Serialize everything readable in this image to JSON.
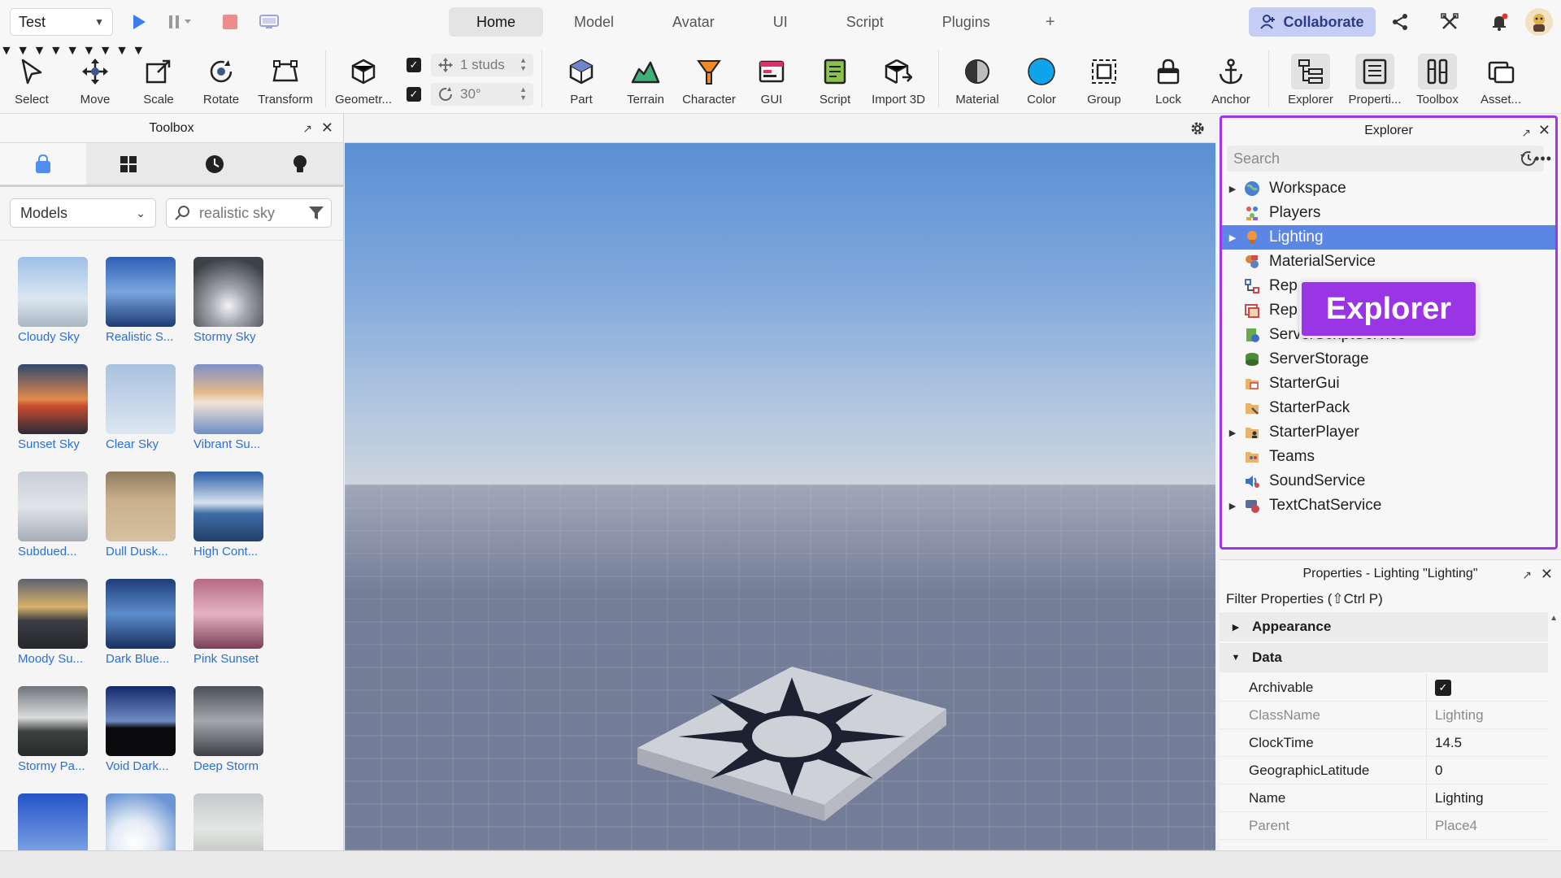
{
  "topbar": {
    "mode": "Test",
    "tabs": [
      "Home",
      "Model",
      "Avatar",
      "UI",
      "Script",
      "Plugins",
      "+"
    ],
    "active_tab": "Home",
    "collaborate": "Collaborate"
  },
  "ribbon": {
    "select": "Select",
    "move": "Move",
    "scale": "Scale",
    "rotate": "Rotate",
    "transform": "Transform",
    "geometry": "Geometr...",
    "move_snap": "1 studs",
    "rotate_snap": "30°",
    "part": "Part",
    "terrain": "Terrain",
    "character": "Character",
    "gui": "GUI",
    "script": "Script",
    "import3d": "Import 3D",
    "material": "Material",
    "color": "Color",
    "group": "Group",
    "lock": "Lock",
    "anchor": "Anchor",
    "explorer": "Explorer",
    "properties": "Properti...",
    "toolbox": "Toolbox",
    "asset": "Asset..."
  },
  "toolbox": {
    "title": "Toolbox",
    "category": "Models",
    "search_value": "realistic sky",
    "assets": [
      {
        "name": "Cloudy Sky"
      },
      {
        "name": "Realistic S..."
      },
      {
        "name": "Stormy Sky"
      },
      {
        "name": "Sunset Sky"
      },
      {
        "name": "Clear Sky"
      },
      {
        "name": "Vibrant Su..."
      },
      {
        "name": "Subdued..."
      },
      {
        "name": "Dull Dusk..."
      },
      {
        "name": "High Cont..."
      },
      {
        "name": "Moody Su..."
      },
      {
        "name": "Dark Blue..."
      },
      {
        "name": "Pink Sunset"
      },
      {
        "name": "Stormy Pa..."
      },
      {
        "name": "Void Dark..."
      },
      {
        "name": "Deep Storm"
      },
      {
        "name": ""
      },
      {
        "name": ""
      },
      {
        "name": ""
      }
    ]
  },
  "explorer": {
    "title": "Explorer",
    "search_placeholder": "Search",
    "callout": "Explorer",
    "items": [
      {
        "label": "Workspace",
        "expand": true,
        "icon": "globe-icon"
      },
      {
        "label": "Players",
        "expand": false,
        "icon": "players-icon"
      },
      {
        "label": "Lighting",
        "expand": true,
        "icon": "lightbulb-icon",
        "selected": true
      },
      {
        "label": "MaterialService",
        "expand": false,
        "icon": "material-service-icon"
      },
      {
        "label": "Rep",
        "expand": false,
        "icon": "replicated-first-icon"
      },
      {
        "label": "Rep",
        "expand": false,
        "icon": "replicated-storage-icon"
      },
      {
        "label": "ServerScriptService",
        "expand": false,
        "icon": "server-script-service-icon"
      },
      {
        "label": "ServerStorage",
        "expand": false,
        "icon": "server-storage-icon"
      },
      {
        "label": "StarterGui",
        "expand": false,
        "icon": "starter-gui-icon"
      },
      {
        "label": "StarterPack",
        "expand": false,
        "icon": "starter-pack-icon"
      },
      {
        "label": "StarterPlayer",
        "expand": true,
        "icon": "starter-player-icon"
      },
      {
        "label": "Teams",
        "expand": false,
        "icon": "teams-icon"
      },
      {
        "label": "SoundService",
        "expand": false,
        "icon": "sound-service-icon"
      },
      {
        "label": "TextChatService",
        "expand": true,
        "icon": "text-chat-service-icon"
      }
    ]
  },
  "properties": {
    "title": "Properties - Lighting \"Lighting\"",
    "filter": "Filter Properties (⇧Ctrl P)",
    "cat_appearance": "Appearance",
    "cat_data": "Data",
    "rows": [
      {
        "key": "Archivable",
        "value": "",
        "checkbox": true
      },
      {
        "key": "ClassName",
        "value": "Lighting",
        "readonly": true
      },
      {
        "key": "ClockTime",
        "value": "14.5"
      },
      {
        "key": "GeographicLatitude",
        "value": "0"
      },
      {
        "key": "Name",
        "value": "Lighting"
      },
      {
        "key": "Parent",
        "value": "Place4",
        "readonly": true
      }
    ]
  },
  "colors": {
    "accent": "#9a35e5",
    "selection": "#5c86e6",
    "link": "#2a6fd6",
    "collaborate_bg": "#c6cdf4"
  }
}
